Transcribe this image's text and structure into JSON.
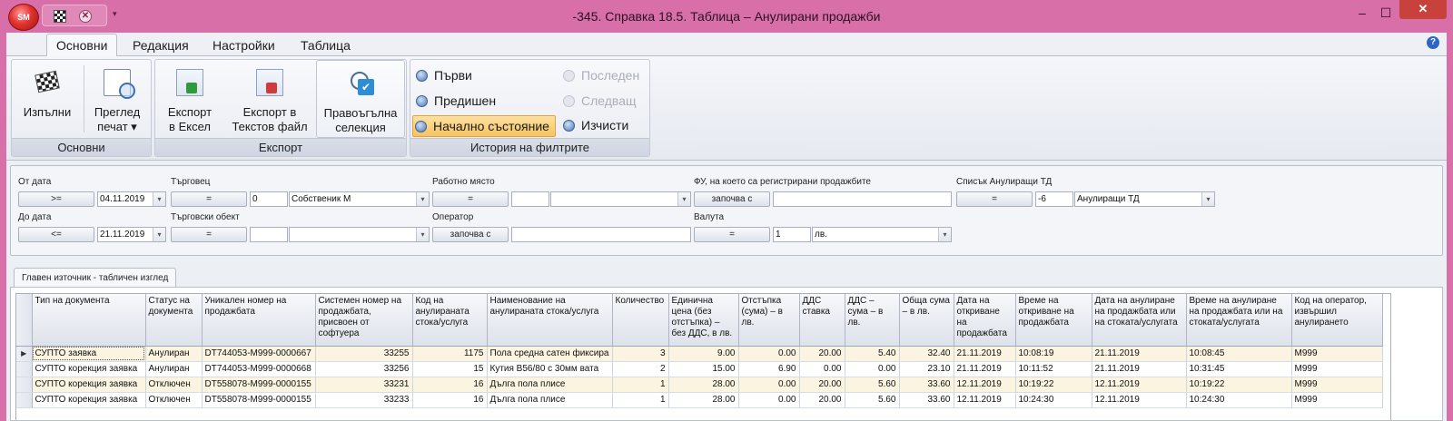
{
  "window": {
    "title": "-345. Справка 18.5. Таблица – Анулирани продажби",
    "orb_label": "SM",
    "qat_cancel_glyph": "✕",
    "qat_dropdown_glyph": "▾",
    "minimize": "–",
    "maximize": "☐",
    "close": "✕"
  },
  "ribbon_tabs": [
    "Основни",
    "Редакция",
    "Настройки",
    "Таблица"
  ],
  "help_glyph": "?",
  "ribbon": {
    "groups": {
      "osnovni": "Основни",
      "export": "Експорт",
      "history": "История на филтрите"
    },
    "buttons": {
      "run_1": "Изпълни",
      "preview_1": "Преглед",
      "preview_2": "печат ▾",
      "excel_1": "Експорт",
      "excel_2": "в Ексел",
      "text_1": "Експорт в",
      "text_2": "Текстов файл",
      "rect_1": "Правоъгълна",
      "rect_2": "селекция"
    },
    "history": {
      "first": "Първи",
      "prev": "Предишен",
      "initial": "Начално състояние",
      "last": "Последен",
      "next": "Следващ",
      "clear": "Изчисти"
    }
  },
  "filters": {
    "from_date": {
      "label": "От дата",
      "op": ">=",
      "value": "04.11.2019"
    },
    "to_date": {
      "label": "До дата",
      "op": "<=",
      "value": "21.11.2019"
    },
    "trader": {
      "label": "Търговец",
      "op": "=",
      "code": "0",
      "name": "Собственик М"
    },
    "trade_object": {
      "label": "Търговски обект",
      "op": "=",
      "code": "",
      "name": ""
    },
    "workplace": {
      "label": "Работно място",
      "op": "=",
      "code": "",
      "name": ""
    },
    "operator": {
      "label": "Оператор",
      "op": "започва с",
      "value": ""
    },
    "fu": {
      "label": "ФУ, на което са регистрирани продажбите",
      "op": "започва с",
      "value": ""
    },
    "currency": {
      "label": "Валута",
      "op": "=",
      "code": "1",
      "name": "лв."
    },
    "cancel_list": {
      "label": "Списък Анулиращи ТД",
      "op": "=",
      "code": "-6",
      "name": "Анулиращи ТД"
    }
  },
  "data_tab": "Главен източник - табличен изглед",
  "grid": {
    "row_indicator": "▶",
    "columns": [
      "Тип на документа",
      "Статус на документа",
      "Уникален номер на продажбата",
      "Системен номер на продажбата, присвоен от софтуера",
      "Код на анулираната стока/услуга",
      "Наименование на анулираната стока/услуга",
      "Количество",
      "Единична цена (без отстъпка) – без ДДС, в лв.",
      "Отстъпка (сума) – в лв.",
      "ДДС ставка",
      "ДДС – сума – в лв.",
      "Обща сума – в лв.",
      "Дата на откриване на продажбата",
      "Време на откриване на продажбата",
      "Дата на анулиране на продажбата или на стоката/услугата",
      "Време на анулиране на продажбата или на стоката/услугата",
      "Код на оператор, извършил анулирането"
    ],
    "rows": [
      [
        "СУПТО заявка",
        "Анулиран",
        "DT744053-M999-0000667",
        "33255",
        "1175",
        "Пола средна сатен фиксира",
        "3",
        "9.00",
        "0.00",
        "20.00",
        "5.40",
        "32.40",
        "21.11.2019",
        "10:08:19",
        "21.11.2019",
        "10:08:45",
        "M999"
      ],
      [
        "СУПТО корекция заявка",
        "Анулиран",
        "DT744053-M999-0000668",
        "33256",
        "15",
        "Кутия B56/80 с 30мм вата",
        "2",
        "15.00",
        "6.90",
        "0.00",
        "0.00",
        "23.10",
        "21.11.2019",
        "10:11:52",
        "21.11.2019",
        "10:31:45",
        "M999"
      ],
      [
        "СУПТО корекция заявка",
        "Отключен",
        "DT558078-M999-0000155",
        "33231",
        "16",
        "Дълга пола плисе",
        "1",
        "28.00",
        "0.00",
        "20.00",
        "5.60",
        "33.60",
        "12.11.2019",
        "10:19:22",
        "12.11.2019",
        "10:19:22",
        "M999"
      ],
      [
        "СУПТО корекция заявка",
        "Отключен",
        "DT558078-M999-0000155",
        "33233",
        "16",
        "Дълга пола плисе",
        "1",
        "28.00",
        "0.00",
        "20.00",
        "5.60",
        "33.60",
        "12.11.2019",
        "10:24:30",
        "12.11.2019",
        "10:24:30",
        "M999"
      ]
    ]
  }
}
